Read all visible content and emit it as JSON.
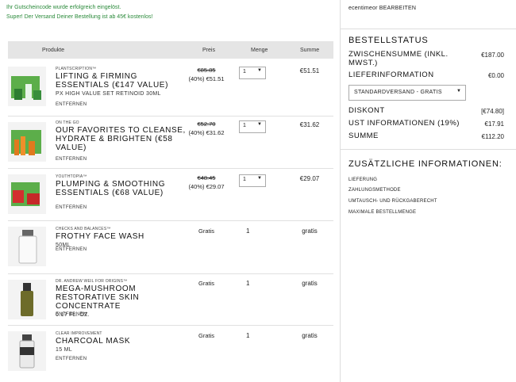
{
  "notices": {
    "voucher": "Ihr Gutscheincode wurde erfolgreich eingelöst.",
    "shipping": "Super! Der Versand Deiner Bestellung ist ab 45€ kostenlos!"
  },
  "cart": {
    "headers": {
      "product": "Produkte",
      "price": "Preis",
      "qty": "Menge",
      "total": "Summe"
    },
    "remove_label": "ENTFERNEN",
    "items": [
      {
        "brand": "PLANTSCRIPTION™",
        "name": "LIFTING & FIRMING ESSENTIALS (€147 VALUE)",
        "size": "PX HIGH VALUE SET RETINOID 30ML",
        "old_price": "€85.85",
        "discount": "(40%) €51.51",
        "qty": "1",
        "total": "€51.51"
      },
      {
        "brand": "ON THE GO",
        "name": "OUR FAVORITES TO CLEANSE, HYDRATE & BRIGHTEN (€58 VALUE)",
        "size": "",
        "old_price": "€52.70",
        "discount": "(40%) €31.62",
        "qty": "1",
        "total": "€31.62"
      },
      {
        "brand": "YOUTHTOPIA™",
        "name": "PLUMPING & SMOOTHING ESSENTIALS (€68 VALUE)",
        "size": "",
        "old_price": "€48.45",
        "discount": "(40%) €29.07",
        "qty": "1",
        "total": "€29.07"
      },
      {
        "brand": "CHECKS AND BALANCES™",
        "name": "FROTHY FACE WASH",
        "size": "50ML",
        "price": "Gratis",
        "qty": "1",
        "total": "gratis"
      },
      {
        "brand": "DR. ANDREW WEIL FOR ORIGINS™",
        "name": "MEGA-MUSHROOM RESTORATIVE SKIN CONCENTRATE",
        "size": "0.17 FL. OZ.",
        "price": "Gratis",
        "qty": "1",
        "total": "gratis"
      },
      {
        "brand": "CLEAR IMPROVEMENT",
        "name": "CHARCOAL MASK",
        "size": "15 ML",
        "price": "Gratis",
        "qty": "1",
        "total": "gratis"
      }
    ]
  },
  "sidebar": {
    "account": "ecentimeor BEARBEITEN",
    "status_title": "BESTELLSTATUS",
    "subtotal_label": "ZWISCHENSUMME (INKL. MWST.)",
    "subtotal_value": "€187.00",
    "delivery_label": "LIEFERINFORMATION",
    "delivery_value": "€0.00",
    "shipping_option": "STANDARDVERSAND - GRATIS",
    "discount_label": "DISKONT",
    "discount_value": "[€74.80]",
    "tax_label": "UST INFORMATIONEN (19%)",
    "tax_value": "€17.91",
    "total_label": "SUMME",
    "total_value": "€112.20",
    "extra_title": "ZUSÄTZLICHE INFORMATIONEN:",
    "links": [
      "LIEFERUNG",
      "ZAHLUNGSMETHODE",
      "UMTAUSCH- UND RÜCKGABERECHT",
      "MAXIMALE BESTELLMENGE"
    ]
  }
}
